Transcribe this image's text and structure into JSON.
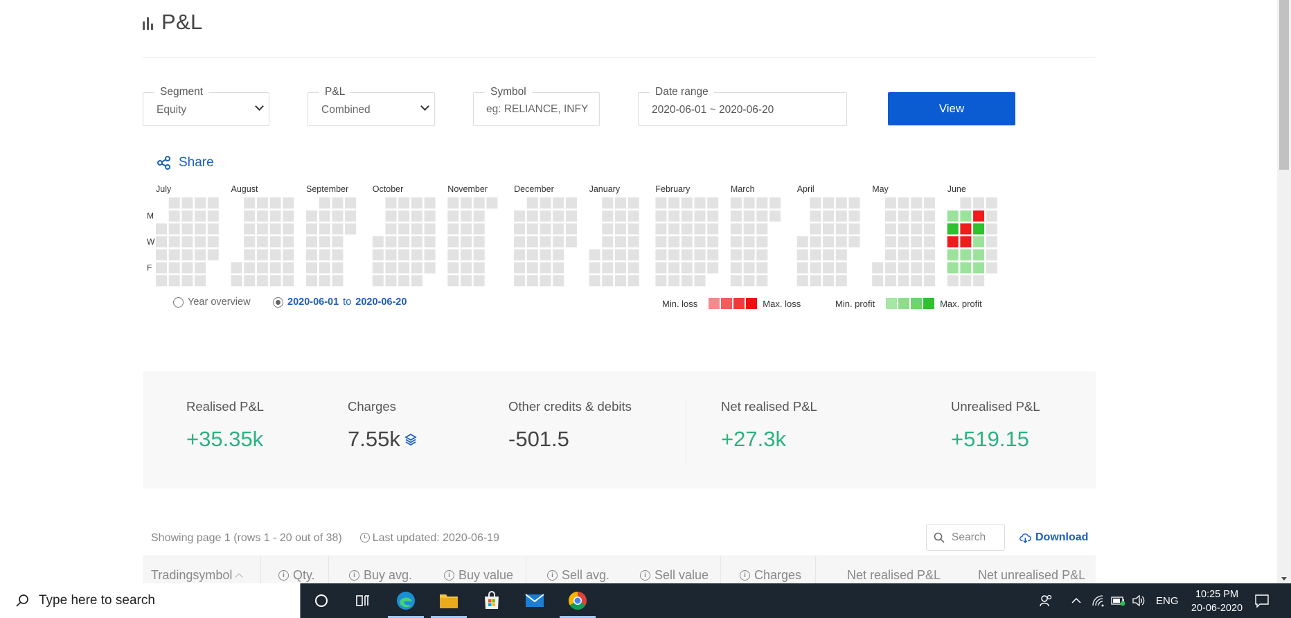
{
  "page": {
    "title": "P&L"
  },
  "filters": {
    "segment": {
      "label": "Segment",
      "value": "Equity"
    },
    "pnl": {
      "label": "P&L",
      "value": "Combined"
    },
    "symbol": {
      "label": "Symbol",
      "placeholder": "eg: RELIANCE, INFY"
    },
    "date_range": {
      "label": "Date range",
      "value": "2020-06-01 ~ 2020-06-20"
    },
    "view_label": "View"
  },
  "share_label": "Share",
  "heatmap": {
    "months": [
      "July",
      "August",
      "September",
      "October",
      "November",
      "December",
      "January",
      "February",
      "March",
      "April",
      "May",
      "June"
    ],
    "day_labels": [
      "M",
      "W",
      "F"
    ],
    "colors": {
      "empty": "#e2e2e2",
      "loss_min": "#f28b8b",
      "loss_max": "#ef1c1c",
      "profit_min": "#9be39b",
      "profit_max": "#2fc12f"
    },
    "june_cells": [
      {
        "week": 0,
        "day": 1,
        "level": "profit_min"
      },
      {
        "week": 1,
        "day": 1,
        "level": "profit_min"
      },
      {
        "week": 2,
        "day": 1,
        "level": "loss_max"
      },
      {
        "week": 0,
        "day": 2,
        "level": "profit_max"
      },
      {
        "week": 1,
        "day": 2,
        "level": "loss_max"
      },
      {
        "week": 2,
        "day": 2,
        "level": "profit_max"
      },
      {
        "week": 0,
        "day": 3,
        "level": "loss_max"
      },
      {
        "week": 1,
        "day": 3,
        "level": "loss_max"
      },
      {
        "week": 2,
        "day": 3,
        "level": "profit_min"
      },
      {
        "week": 0,
        "day": 4,
        "level": "profit_min"
      },
      {
        "week": 1,
        "day": 4,
        "level": "profit_min"
      },
      {
        "week": 2,
        "day": 4,
        "level": "profit_min"
      },
      {
        "week": 0,
        "day": 5,
        "level": "profit_min"
      },
      {
        "week": 1,
        "day": 5,
        "level": "profit_min"
      },
      {
        "week": 2,
        "day": 5,
        "level": "profit_min"
      }
    ]
  },
  "range_options": {
    "year_overview": "Year overview",
    "from": "2020-06-01",
    "to_word": "to",
    "to": "2020-06-20"
  },
  "legend": {
    "min_loss": "Min. loss",
    "max_loss": "Max. loss",
    "min_profit": "Min. profit",
    "max_profit": "Max. profit",
    "loss_swatches": [
      "#f28b8b",
      "#f25c5c",
      "#f03a3a",
      "#ef1010"
    ],
    "profit_swatches": [
      "#a6e6a6",
      "#8cdd8c",
      "#6fd36f",
      "#2fc12f"
    ]
  },
  "summary": {
    "realised": {
      "label": "Realised P&L",
      "value": "+35.35k"
    },
    "charges": {
      "label": "Charges",
      "value": "7.55k"
    },
    "other": {
      "label": "Other credits & debits",
      "value": "-501.5"
    },
    "net_realised": {
      "label": "Net realised P&L",
      "value": "+27.3k"
    },
    "unrealised": {
      "label": "Unrealised P&L",
      "value": "+519.15"
    }
  },
  "table": {
    "showing": "Showing page 1 (rows 1 - 20 out of 38)",
    "last_updated": "Last updated: 2020-06-19",
    "search_placeholder": "Search",
    "download_label": "Download",
    "columns": [
      "Tradingsymbol",
      "Qty.",
      "Buy avg.",
      "Buy value",
      "Sell avg.",
      "Sell value",
      "Charges",
      "Net realised P&L",
      "Net unrealised P&L"
    ]
  },
  "taskbar": {
    "search_placeholder": "Type here to search",
    "language": "ENG",
    "time": "10:25 PM",
    "date": "20-06-2020"
  }
}
